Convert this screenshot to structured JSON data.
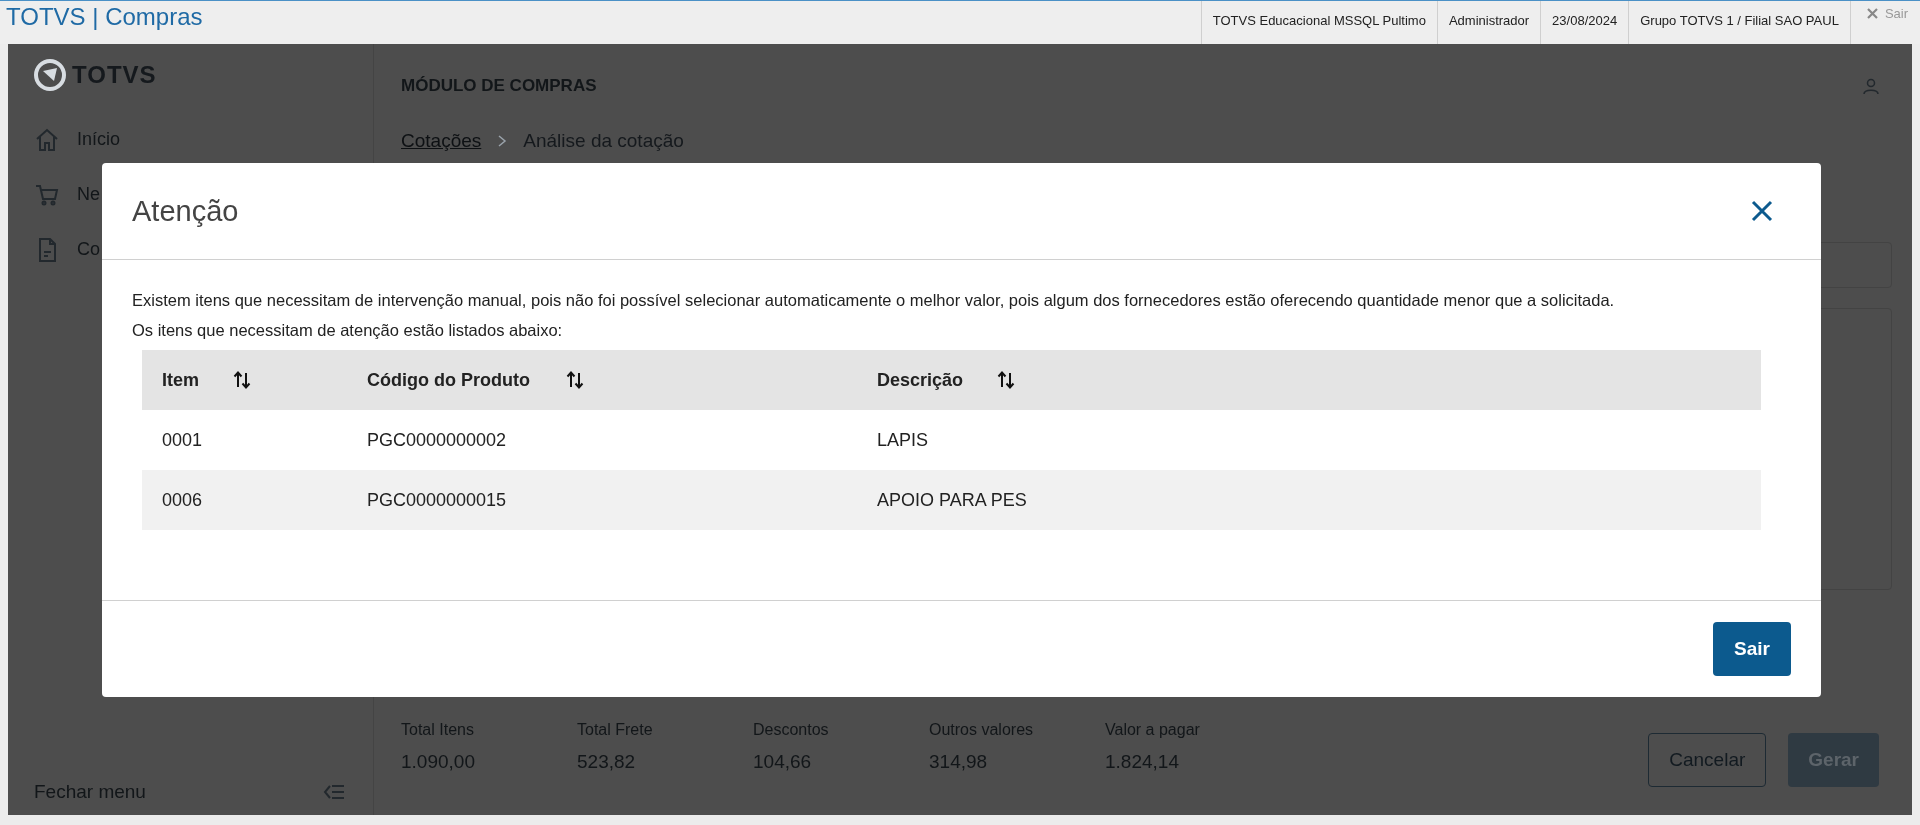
{
  "header": {
    "title": "TOTVS | Compras",
    "info": [
      "TOTVS Educacional MSSQL Pultimo",
      "Administrador",
      "23/08/2024",
      "Grupo TOTVS 1 / Filial SAO PAUL"
    ],
    "exit": "Sair"
  },
  "sidebar": {
    "logo": "TOTVS",
    "items": [
      {
        "label": "Início",
        "kind": "home"
      },
      {
        "label": "Ne",
        "kind": "cart"
      },
      {
        "label": "Co",
        "kind": "document"
      }
    ],
    "collapse": "Fechar menu"
  },
  "page": {
    "module": "MÓDULO DE COMPRAS",
    "breadcrumb": [
      "Cotações",
      "Análise da cotação"
    ],
    "totals": [
      {
        "label": "Total Itens",
        "value": "1.090,00"
      },
      {
        "label": "Total Frete",
        "value": "523,82"
      },
      {
        "label": "Descontos",
        "value": "104,66"
      },
      {
        "label": "Outros valores",
        "value": "314,98"
      },
      {
        "label": "Valor a pagar",
        "value": "1.824,14"
      }
    ],
    "buttons": [
      {
        "label": "Cancelar",
        "kind": "secondary"
      },
      {
        "label": "Gerar",
        "kind": "primary"
      }
    ]
  },
  "dialog": {
    "title": "Atenção",
    "message": [
      "Existem itens que necessitam de intervenção manual, pois não foi possível selecionar automaticamente o melhor valor, pois algum dos fornecedores estão oferecendo quantidade menor que a solicitada.",
      "Os itens que necessitam de atenção estão listados abaixo:"
    ],
    "table": {
      "columns": [
        "Item",
        "Código do Produto",
        "Descrição"
      ],
      "rows": [
        [
          "0001",
          "PGC0000000002",
          "LAPIS"
        ],
        [
          "0006",
          "PGC0000000015",
          "APOIO PARA PES"
        ]
      ]
    },
    "button": "Sair"
  }
}
